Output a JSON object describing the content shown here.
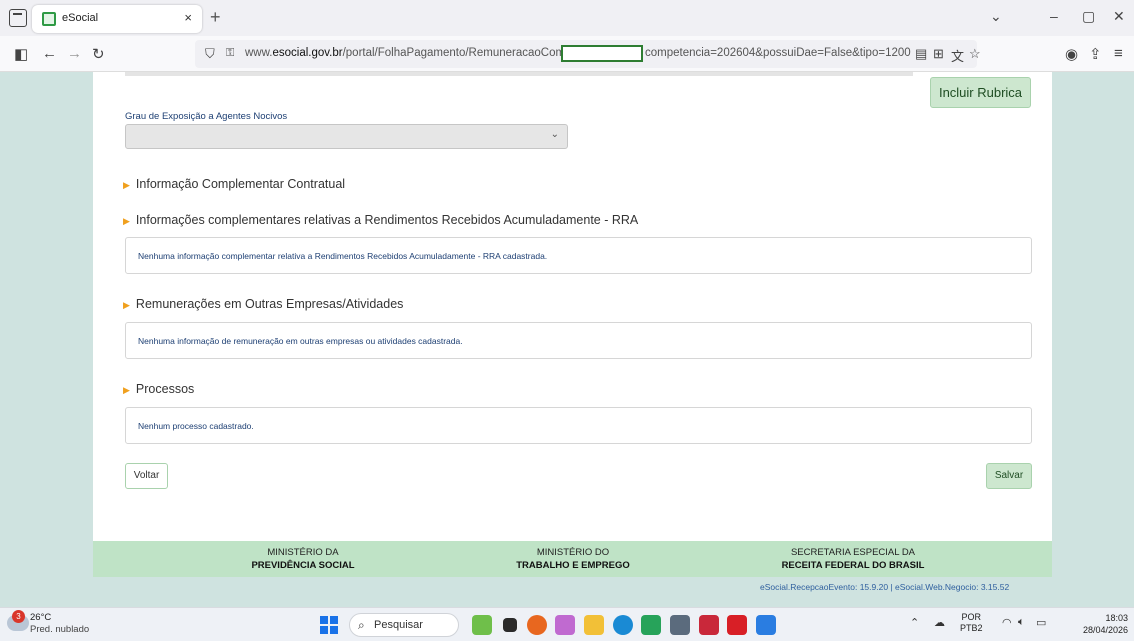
{
  "browser": {
    "tab_title": "eSocial",
    "tab_close": "×",
    "new_tab": "+",
    "url_prefix": "www.",
    "url_domain": "esocial.gov.br",
    "url_path": "/portal/FolhaPagamento/RemuneracaoCompleto?",
    "url_suffix": "competencia=202604&possuiDae=False&tipo=1200",
    "window_controls": [
      "chevron-down-icon",
      "minimize-icon",
      "restore-icon",
      "close-icon"
    ]
  },
  "form": {
    "incluir_rubrica": "Incluir Rubrica",
    "grau_label": "Grau de Exposição a Agentes Nocivos",
    "grau_value": "",
    "sections": [
      {
        "title": "Informação Complementar Contratual",
        "text": null
      },
      {
        "title": "Informações complementares relativas a Rendimentos Recebidos Acumuladamente - RRA",
        "text": "Nenhuma informação complementar relativa a Rendimentos Recebidos Acumuladamente - RRA cadastrada."
      },
      {
        "title": "Remunerações em Outras Empresas/Atividades",
        "text": "Nenhuma informação de remuneração em outras empresas ou atividades cadastrada."
      },
      {
        "title": "Processos",
        "text": "Nenhum processo cadastrado."
      }
    ],
    "voltar": "Voltar",
    "salvar": "Salvar"
  },
  "footer": {
    "items": [
      {
        "line1": "MINISTÉRIO DA",
        "line2": "PREVIDÊNCIA SOCIAL"
      },
      {
        "line1": "MINISTÉRIO DO",
        "line2": "TRABALHO E EMPREGO"
      },
      {
        "line1": "SECRETARIA ESPECIAL DA",
        "line2": "RECEITA FEDERAL DO BRASIL"
      }
    ],
    "version": "eSocial.RecepcaoEvento: 15.9.20 | eSocial.Web.Negocio: 3.15.52"
  },
  "taskbar": {
    "weather_badge": "3",
    "temperature": "26°C",
    "weather_desc": "Pred. nublado",
    "search_placeholder": "Pesquisar",
    "lang_line1": "POR",
    "lang_line2": "PTB2",
    "time": "18:03",
    "date": "28/04/2026"
  },
  "colors": {
    "accent_green": "#cde7cf",
    "label_blue": "#1d3f73",
    "triangle_orange": "#f0a01e",
    "footer_green": "#bfe3c6"
  }
}
